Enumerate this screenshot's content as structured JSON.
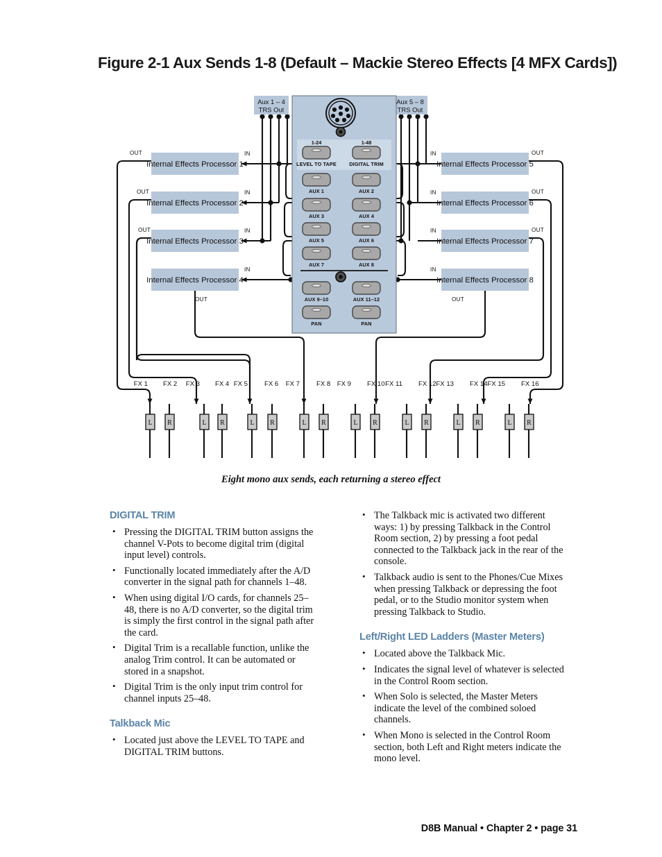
{
  "figure": {
    "title": "Figure 2-1 Aux Sends 1-8 (Default – Mackie Stereo Effects [4 MFX Cards])",
    "caption": "Eight mono aux sends, each returning a stereo effect"
  },
  "diagram": {
    "trs_left": {
      "line1": "Aux 1 – 4",
      "line2": "TRS Out"
    },
    "trs_right": {
      "line1": "Aux 5 – 8",
      "line2": "TRS Out"
    },
    "io_in": "IN",
    "io_out": "OUT",
    "processors_left": [
      "Internal Effects Processor 1",
      "Internal Effects Processor 2",
      "Internal Effects Processor 3",
      "Internal Effects Processor 4"
    ],
    "processors_right": [
      "Internal Effects Processor 5",
      "Internal Effects Processor 6",
      "Internal Effects Processor 7",
      "Internal Effects Processor 8"
    ],
    "panel": {
      "top_buttons": [
        {
          "range": "1-24",
          "label": "LEVEL TO TAPE"
        },
        {
          "range": "1-48",
          "label": "DIGITAL TRIM"
        }
      ],
      "aux_buttons": [
        "AUX 1",
        "AUX 2",
        "AUX 3",
        "AUX 4",
        "AUX 5",
        "AUX 6",
        "AUX 7",
        "AUX 8"
      ],
      "pan_buttons": [
        "AUX 9–10",
        "AUX 11–12",
        "PAN",
        "PAN"
      ]
    },
    "fx_labels": [
      "FX 1",
      "FX 2",
      "FX 3",
      "FX 4",
      "FX 5",
      "FX 6",
      "FX 7",
      "FX 8",
      "FX 9",
      "FX 10",
      "FX 11",
      "FX 12",
      "FX 13",
      "FX 14",
      "FX 15",
      "FX 16"
    ],
    "channel_letters": [
      "L",
      "R",
      "L",
      "R",
      "L",
      "R",
      "L",
      "R",
      "L",
      "R",
      "L",
      "R",
      "L",
      "R",
      "L",
      "R"
    ],
    "colors": {
      "box_fill": "#b7c7da",
      "panel_fill": "#b9c9dc",
      "panel_inner": "#ccd9e7",
      "button_fill": "#a8a8a8",
      "lr_fill": "#c9c9c9",
      "wire": "#111111",
      "heading": "#5b84a8"
    }
  },
  "sections": [
    {
      "id": "digital-trim",
      "heading": "DIGITAL TRIM",
      "bullets": [
        "Pressing the DIGITAL TRIM button assigns the channel V-Pots to become digital trim (digital input level) controls.",
        "Functionally located immediately after the A/D converter in the signal path for channels 1–48.",
        "When using digital I/O cards, for channels 25–48, there is no A/D converter, so the digital trim is simply the first control in the signal path after the card.",
        "Digital Trim is a recallable function, unlike the analog Trim control. It can be automated or stored in a snapshot.",
        "Digital Trim is the only input trim control for channel inputs 25–48."
      ]
    },
    {
      "id": "talkback-mic",
      "heading": "Talkback Mic",
      "bullets": [
        "Located just above the LEVEL TO TAPE and DIGITAL TRIM buttons."
      ]
    },
    {
      "id": "talkback-mic-cont",
      "heading": "",
      "bullets": [
        "The Talkback mic is activated two different ways: 1) by pressing Talkback in the Control Room section, 2) by pressing a foot pedal connected to the Talkback jack in the rear of the console.",
        "Talkback audio is sent to the Phones/Cue Mixes when pressing Talkback or depressing the foot pedal, or to the Studio monitor system when pressing Talkback to Studio."
      ]
    },
    {
      "id": "led-ladders",
      "heading": "Left/Right LED Ladders (Master Meters)",
      "bullets": [
        "Located above the Talkback Mic.",
        "Indicates the signal level of whatever is selected in the Control Room section.",
        "When Solo is selected, the Master Meters indicate the level of the combined soloed channels.",
        "When Mono is selected in the Control Room section, both Left and Right meters indicate the mono level."
      ]
    }
  ],
  "footer": {
    "text": "D8B Manual • Chapter 2 • page 31"
  }
}
